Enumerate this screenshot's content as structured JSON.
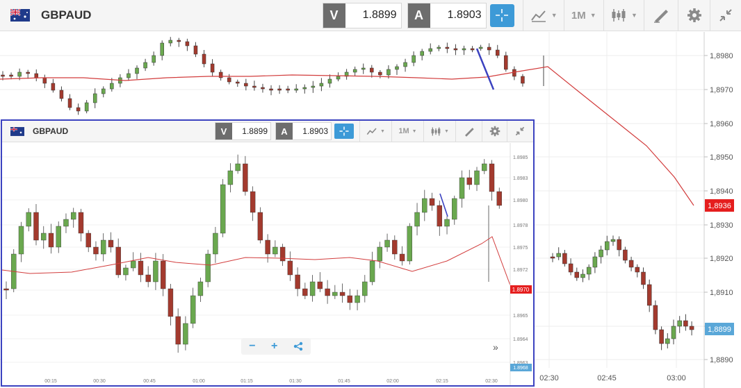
{
  "toolbar": {
    "symbol": "GBPAUD",
    "sell_letter": "V",
    "sell_price": "1.8899",
    "buy_letter": "A",
    "buy_price": "1.8903",
    "timeframe": "1M",
    "icons": [
      "flag-uk-au-icon",
      "crosshair-icon",
      "chart-type-icon",
      "candles-icon",
      "draw-tools-icon",
      "gear-icon",
      "collapse-icon"
    ]
  },
  "main_chart": {
    "y_ticks": [
      "1,8980",
      "1,8970",
      "1,8960",
      "1,8950",
      "1,8940",
      "1,8930",
      "1,8920",
      "1,8910",
      "1,8900",
      "1,8890"
    ],
    "x_ticks": [
      "02:30",
      "02:45",
      "03:00"
    ],
    "price_badge_red": "1,8936",
    "price_badge_blue": "1,8899",
    "colors": {
      "up": "#6aa84f",
      "down": "#a33a2e",
      "ma": "#d23c3c",
      "trendline": "#3b42c0",
      "badge_red": "#e51e1e",
      "badge_blue": "#5aa7d8"
    }
  },
  "inset": {
    "symbol": "GBPAUD",
    "sell_letter": "V",
    "sell_price": "1.8899",
    "buy_letter": "A",
    "buy_price": "1.8903",
    "timeframe": "1M",
    "y_ticks": [
      "1.8985",
      "1.8983",
      "1.8980",
      "1.8978",
      "1.8975",
      "1.8972",
      "1.8970",
      "1.8965",
      "1.8964",
      "1.8963"
    ],
    "x_ticks": [
      "00:15",
      "00:30",
      "00:45",
      "01:00",
      "01:15",
      "01:30",
      "01:45",
      "02:00",
      "02:15",
      "02:30"
    ],
    "badge_red": "1.8970",
    "badge_blue": "1.8968",
    "zoom_minus": "−",
    "zoom_plus": "+",
    "forward": "»"
  }
}
